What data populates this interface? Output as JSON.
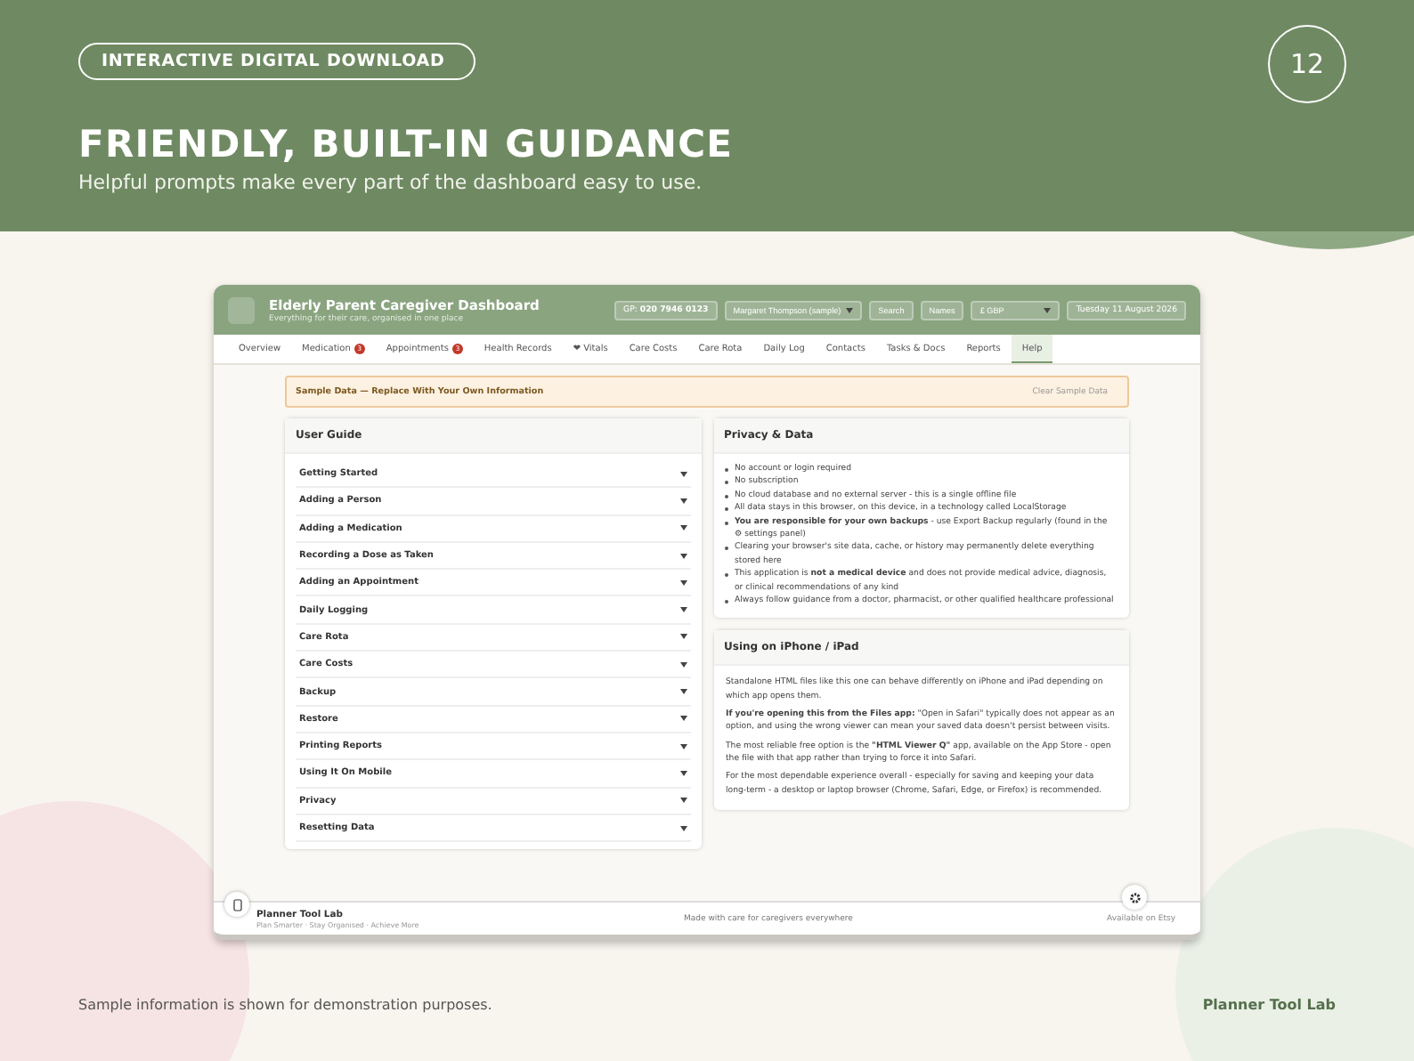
{
  "hero": {
    "badge": "INTERACTIVE DIGITAL DOWNLOAD",
    "page_number": "12",
    "title": "FRIENDLY, BUILT-IN GUIDANCE",
    "subtitle": "Helpful prompts make every part of the dashboard easy to use."
  },
  "dashboard": {
    "title": "Elderly Parent Caregiver Dashboard",
    "tagline": "Everything for their care, organised in one place",
    "gp": "GP: **020 7946 0123**",
    "person_select": "Margaret Thompson (sample)",
    "search_button": "Search",
    "names_button": "Names",
    "currency_select": "£ GBP",
    "date": "Tuesday 11 August 2026",
    "tabs": [
      {
        "label": "Overview",
        "selected": false
      },
      {
        "label": "Medication",
        "badge": "3",
        "selected": false
      },
      {
        "label": "Appointments",
        "badge": "3",
        "selected": false
      },
      {
        "label": "Health Records",
        "selected": false
      },
      {
        "label": "❤ Vitals",
        "selected": false
      },
      {
        "label": "Care Costs",
        "selected": false
      },
      {
        "label": "Care Rota",
        "selected": false
      },
      {
        "label": "Daily Log",
        "selected": false
      },
      {
        "label": "Contacts",
        "selected": false
      },
      {
        "label": "Tasks & Docs",
        "selected": false
      },
      {
        "label": "Reports",
        "selected": false
      },
      {
        "label": "Help",
        "selected": true
      }
    ],
    "sample_banner": {
      "text": "Sample Data — Replace With Your Own Information",
      "button": "Clear Sample Data"
    },
    "user_guide": {
      "title": "User Guide",
      "items": [
        {
          "label": "Getting Started",
          "expanded": false
        },
        {
          "label": "Adding a Person",
          "expanded": false
        },
        {
          "label": "Adding a Medication",
          "expanded": false
        },
        {
          "label": "Recording a Dose as Taken",
          "expanded": false
        },
        {
          "label": "Adding an Appointment",
          "expanded": false
        },
        {
          "label": "Daily Logging",
          "expanded": false
        },
        {
          "label": "Care Rota",
          "expanded": false
        },
        {
          "label": "Care Costs",
          "expanded": false
        },
        {
          "label": "Backup",
          "expanded": false
        },
        {
          "label": "Restore",
          "expanded": false
        },
        {
          "label": "Printing Reports",
          "expanded": false
        },
        {
          "label": "Using It On Mobile",
          "expanded": false
        },
        {
          "label": "Privacy",
          "expanded": false
        },
        {
          "label": "Resetting Data",
          "expanded": false
        }
      ]
    },
    "privacy": {
      "title": "Privacy & Data",
      "items": [
        "No account or login required",
        "No subscription",
        "No cloud database and no external server - this is a single offline file",
        "All data stays in this browser, on this device, in a technology called LocalStorage",
        "**You are responsible for your own backups** - use Export Backup regularly (found in the ⚙ settings panel)",
        "Clearing your browser's site data, cache, or history may permanently delete everything stored here",
        "This application is **not a medical device** and does not provide medical advice, diagnosis, or clinical recommendations of any kind",
        "Always follow guidance from a doctor, pharmacist, or other qualified healthcare professional"
      ]
    },
    "mobile": {
      "title": "Using on iPhone / iPad",
      "paragraphs": [
        "Standalone HTML files like this one can behave differently on iPhone and iPad depending on which app opens them.",
        "**If you're opening this from the Files app:** \"Open in Safari\" typically does not appear as an option, and using the wrong viewer can mean your saved data doesn't persist between visits.",
        "The most reliable free option is the **\"HTML Viewer Q\"** app, available on the App Store - open the file with that app rather than trying to force it into Safari.",
        "For the most dependable experience overall - especially for saving and keeping your data long-term - a desktop or laptop browser (Chrome, Safari, Edge, or Firefox) is recommended."
      ]
    },
    "footer": {
      "brand": "Planner Tool Lab",
      "slogan": "Plan Smarter · Stay Organised · Achieve More",
      "center": "Made with care for caregivers everywhere",
      "right": "Available on Etsy"
    }
  },
  "page_footer": {
    "note": "Sample information is shown for demonstration purposes.",
    "brand": "Planner Tool Lab"
  }
}
